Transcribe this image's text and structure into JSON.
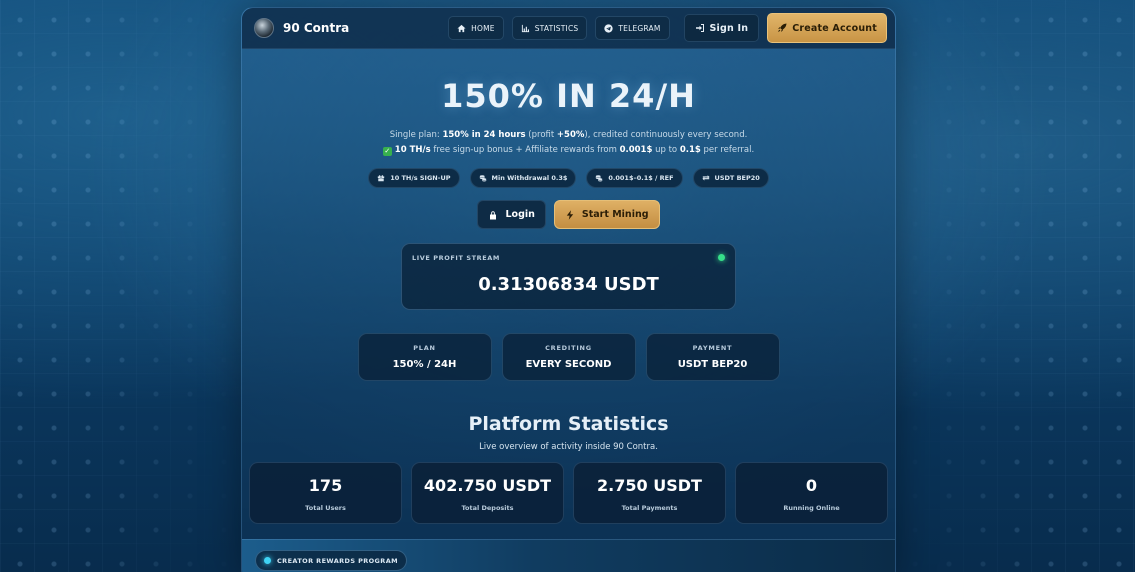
{
  "brand": {
    "name": "90 Contra"
  },
  "nav": {
    "home": "HOME",
    "statistics": "STATISTICS",
    "telegram": "TELEGRAM",
    "sign_in": "Sign In",
    "create_account": "Create Account"
  },
  "hero": {
    "title": "150% IN 24/H",
    "line1_prefix": "Single plan: ",
    "line1_bold1": "150% in 24 hours",
    "line1_mid": " (profit ",
    "line1_bold2": "+50%",
    "line1_suffix": "), credited continuously every second.",
    "line2_bold1": "10 TH/s",
    "line2_mid1": " free sign-up bonus + Affiliate rewards from ",
    "line2_bold2": "0.001$",
    "line2_mid2": " up to ",
    "line2_bold3": "0.1$",
    "line2_suffix": " per referral."
  },
  "chips": [
    {
      "label": "10 TH/s SIGN-UP",
      "icon": "gift-icon"
    },
    {
      "label": "Min Withdrawal 0.3$",
      "icon": "coins-icon"
    },
    {
      "label": "0.001$–0.1$ / REF",
      "icon": "coins-icon"
    },
    {
      "label": "USDT BEP20",
      "icon": "swap-icon"
    }
  ],
  "cta": {
    "login": "Login",
    "start": "Start Mining"
  },
  "stream": {
    "label": "LIVE PROFIT STREAM",
    "value": "0.31306834 USDT"
  },
  "plan_cards": [
    {
      "key": "PLAN",
      "value": "150% / 24H"
    },
    {
      "key": "CREDITING",
      "value": "EVERY SECOND"
    },
    {
      "key": "PAYMENT",
      "value": "USDT BEP20"
    }
  ],
  "stats": {
    "title": "Platform Statistics",
    "subtitle": "Live overview of activity inside 90 Contra.",
    "cards": [
      {
        "value": "175",
        "label": "Total Users"
      },
      {
        "value": "402.750 USDT",
        "label": "Total Deposits"
      },
      {
        "value": "2.750 USDT",
        "label": "Total Payments"
      },
      {
        "value": "0",
        "label": "Running Online"
      }
    ]
  },
  "creator": {
    "badge": "CREATOR REWARDS PROGRAM"
  },
  "colors": {
    "accent_gold": "#d7a75a",
    "live_green": "#36e08a",
    "creator_cyan": "#3fd3f5"
  }
}
